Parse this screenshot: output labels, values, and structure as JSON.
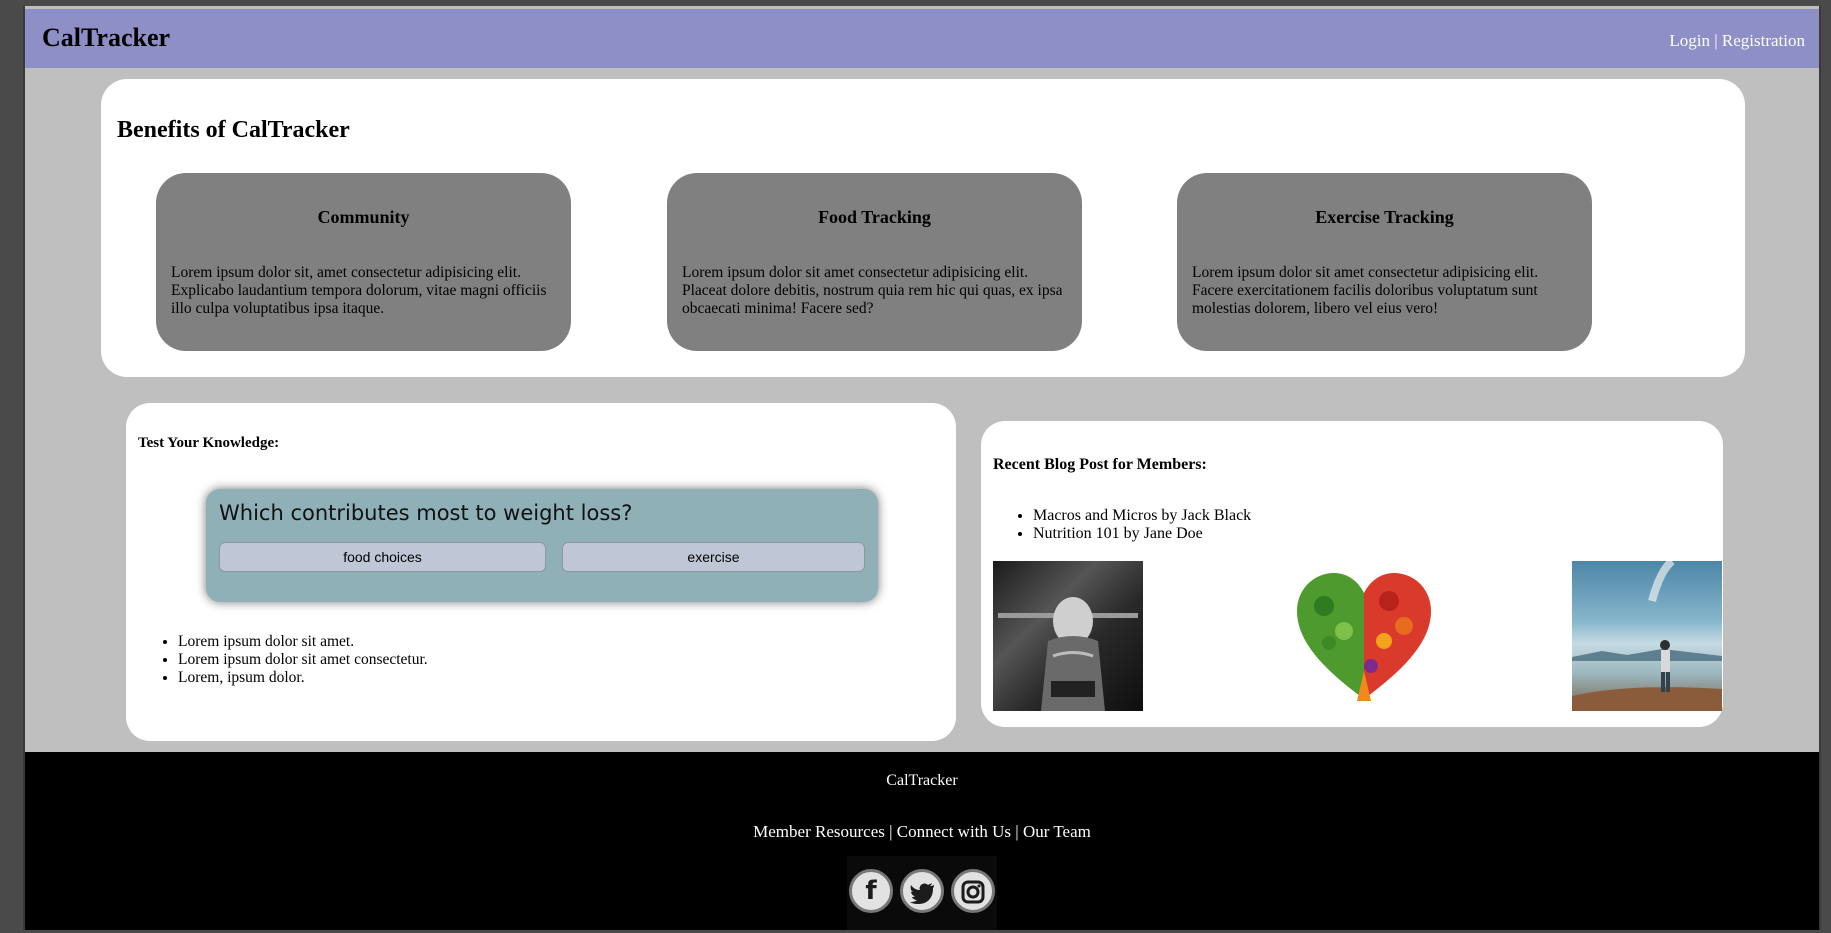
{
  "header": {
    "brand": "CalTracker",
    "login": "Login",
    "separator": "|",
    "registration": "Registration"
  },
  "benefits": {
    "title": "Benefits of CalTracker",
    "cards": [
      {
        "title": "Community",
        "text": "Lorem ipsum dolor sit, amet consectetur adipisicing elit. Explicabo laudantium tempora dolorum, vitae magni officiis illo culpa voluptatibus ipsa itaque."
      },
      {
        "title": "Food Tracking",
        "text": "Lorem ipsum dolor sit amet consectetur adipisicing elit. Placeat dolore debitis, nostrum quia rem hic qui quas, ex ipsa obcaecati minima! Facere sed?"
      },
      {
        "title": "Exercise Tracking",
        "text": "Lorem ipsum dolor sit amet consectetur adipisicing elit. Facere exercitationem facilis doloribus voluptatum sunt molestias dolorem, libero vel eius vero!"
      }
    ]
  },
  "quiz": {
    "title": "Test Your Knowledge:",
    "question": "Which contributes most to weight loss?",
    "options": [
      "food choices",
      "exercise"
    ],
    "list": [
      "Lorem ipsum dolor sit amet.",
      "Lorem ipsum dolor sit amet consectetur.",
      "Lorem, ipsum dolor."
    ]
  },
  "blog": {
    "title": "Recent Blog Post for Members:",
    "posts": [
      "Macros and Micros by Jack Black",
      "Nutrition 101 by Jane Doe"
    ],
    "images": [
      "gym-photo",
      "vegetable-heart-photo",
      "lake-photo"
    ]
  },
  "footer": {
    "brand": "CalTracker",
    "links": [
      "Member Resources",
      "Connect with Us",
      "Our Team"
    ],
    "separator": "|",
    "social_icons": [
      "facebook-icon",
      "twitter-icon",
      "instagram-icon"
    ]
  },
  "colors": {
    "header_bg": "#8e8fc6",
    "page_bg": "#bfbfbf",
    "card_bg": "#808080",
    "quiz_bg": "#8fb0b7",
    "quiz_button_bg": "#bfc7d6",
    "footer_bg": "#000000"
  }
}
